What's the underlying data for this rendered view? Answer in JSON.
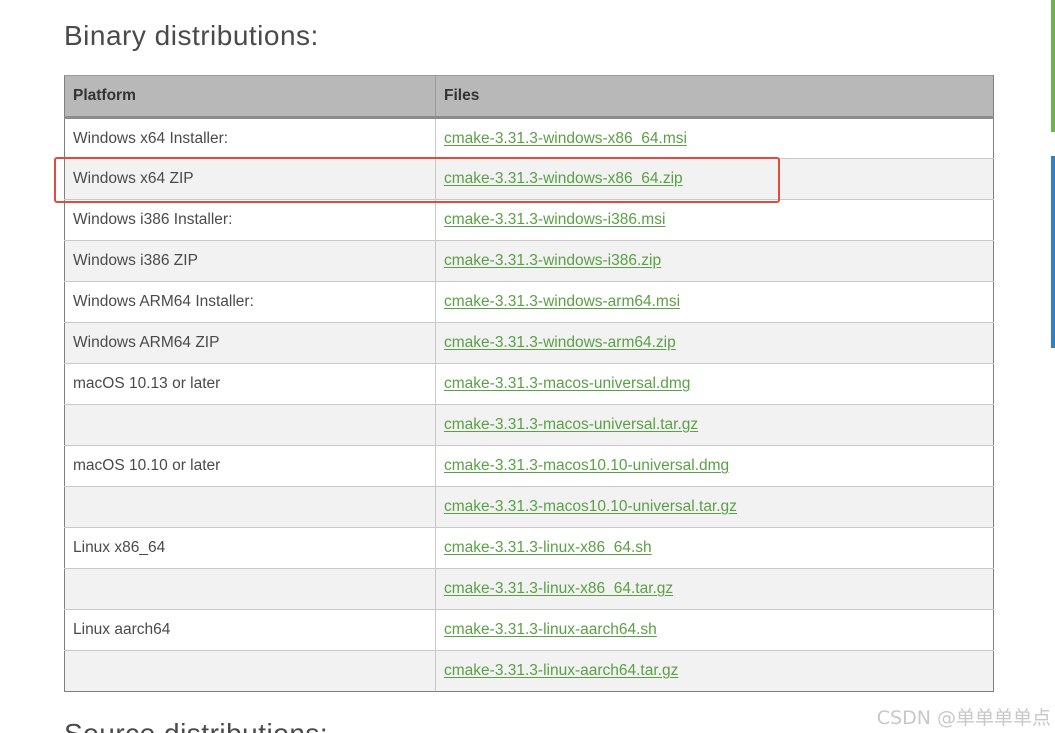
{
  "section_title": "Binary distributions:",
  "next_section_title": "Source distributions:",
  "table": {
    "headers": [
      "Platform",
      "Files"
    ],
    "rows": [
      {
        "platform": "Windows x64 Installer:",
        "file": "cmake-3.31.3-windows-x86_64.msi"
      },
      {
        "platform": "Windows x64 ZIP",
        "file": "cmake-3.31.3-windows-x86_64.zip"
      },
      {
        "platform": "Windows i386 Installer:",
        "file": "cmake-3.31.3-windows-i386.msi"
      },
      {
        "platform": "Windows i386 ZIP",
        "file": "cmake-3.31.3-windows-i386.zip"
      },
      {
        "platform": "Windows ARM64 Installer:",
        "file": "cmake-3.31.3-windows-arm64.msi"
      },
      {
        "platform": "Windows ARM64 ZIP",
        "file": "cmake-3.31.3-windows-arm64.zip"
      },
      {
        "platform": "macOS 10.13 or later",
        "file": "cmake-3.31.3-macos-universal.dmg"
      },
      {
        "platform": "",
        "file": "cmake-3.31.3-macos-universal.tar.gz"
      },
      {
        "platform": "macOS 10.10 or later",
        "file": "cmake-3.31.3-macos10.10-universal.dmg"
      },
      {
        "platform": "",
        "file": "cmake-3.31.3-macos10.10-universal.tar.gz"
      },
      {
        "platform": "Linux x86_64",
        "file": "cmake-3.31.3-linux-x86_64.sh"
      },
      {
        "platform": "",
        "file": "cmake-3.31.3-linux-x86_64.tar.gz"
      },
      {
        "platform": "Linux aarch64",
        "file": "cmake-3.31.3-linux-aarch64.sh"
      },
      {
        "platform": "",
        "file": "cmake-3.31.3-linux-aarch64.tar.gz"
      }
    ]
  },
  "watermark": "CSDN @单单单单点",
  "colors": {
    "link": "#5ba046",
    "header_bg": "#b8b8b8",
    "highlight": "#e04a3f"
  }
}
